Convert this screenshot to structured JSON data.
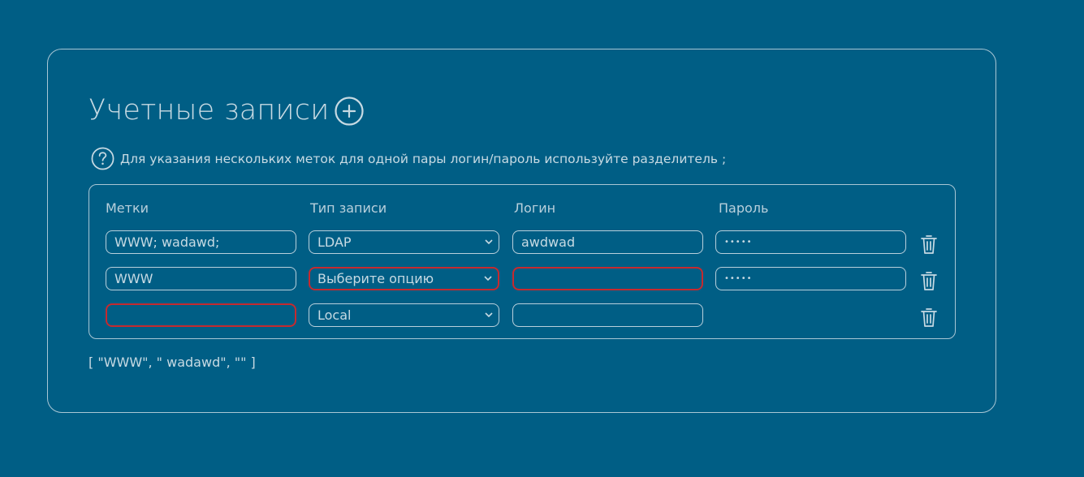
{
  "accounts": {
    "title": "Учетные записи",
    "add_icon": "plus-circle-icon",
    "hint_icon": "question-circle-icon",
    "hint": "Для указания нескольких меток для одной пары логин/пароль используйте разделитель ;",
    "columns": {
      "labels": "Метки",
      "type": "Тип записи",
      "login": "Логин",
      "password": "Пароль"
    },
    "rows": [
      {
        "labels": "WWW; wadawd;",
        "type": "LDAP",
        "login": "awdwad",
        "password": "•••••",
        "invalid_fields": []
      },
      {
        "labels": "WWW",
        "type": "Выберите опцию",
        "login": "",
        "password": "•••••",
        "invalid_fields": [
          "type",
          "login"
        ]
      },
      {
        "labels": "",
        "type": "Local",
        "login": "",
        "password": null,
        "invalid_fields": [
          "labels"
        ]
      }
    ],
    "delete_icon": "trash-icon",
    "output": "[ \"WWW\", \" wadawd\", \"\" ]"
  },
  "colors": {
    "background": "#005e85",
    "text": "#c7dae3",
    "border": "#a9c7d5",
    "invalid": "#c62a2f"
  }
}
